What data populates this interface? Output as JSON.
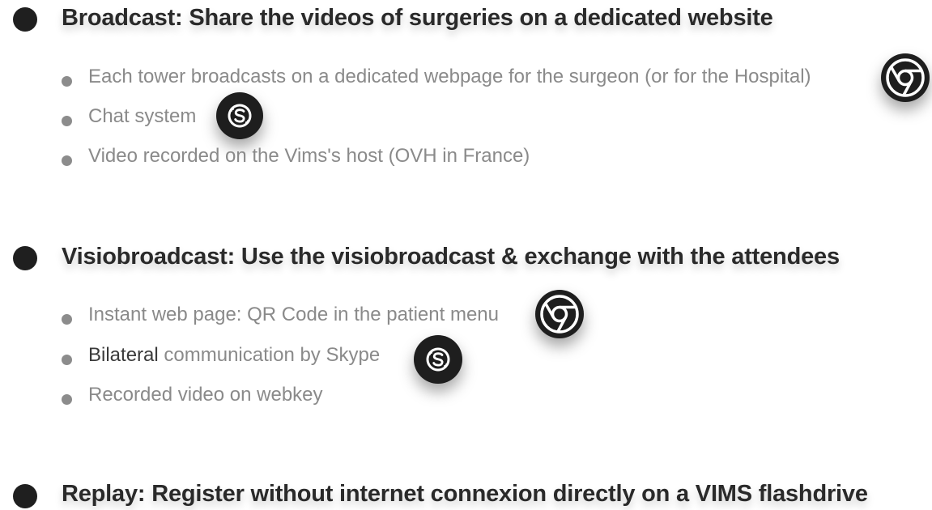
{
  "sections": [
    {
      "heading": "Broadcast: Share the videos of surgeries on a dedicated website",
      "items": [
        {
          "text": "Each tower broadcasts on a dedicated webpage for the surgeon (or for the Hospital)",
          "icon": "chrome-icon"
        },
        {
          "text": "Chat system",
          "icon": "skype-icon"
        },
        {
          "text": "Video recorded on the Vims's host (OVH in France)"
        }
      ]
    },
    {
      "heading": "Visiobroadcast: Use the visiobroadcast & exchange with the attendees",
      "items": [
        {
          "text": "Instant web page: QR Code in the patient menu",
          "icon": "chrome-icon"
        },
        {
          "text_dark": "Bilateral",
          "text": " communication by Skype",
          "icon": "skype-icon"
        },
        {
          "text": "Recorded video on webkey"
        }
      ]
    },
    {
      "heading": "Replay: Register without internet connexion directly on a VIMS flashdrive",
      "items": []
    }
  ],
  "colors": {
    "heading": "#2a2a2a",
    "item_text": "#8a8a8a",
    "bullet_big": "#1f1f1f",
    "bullet_small": "#8c8c8c",
    "badge_bg": "#1e1e1e"
  }
}
